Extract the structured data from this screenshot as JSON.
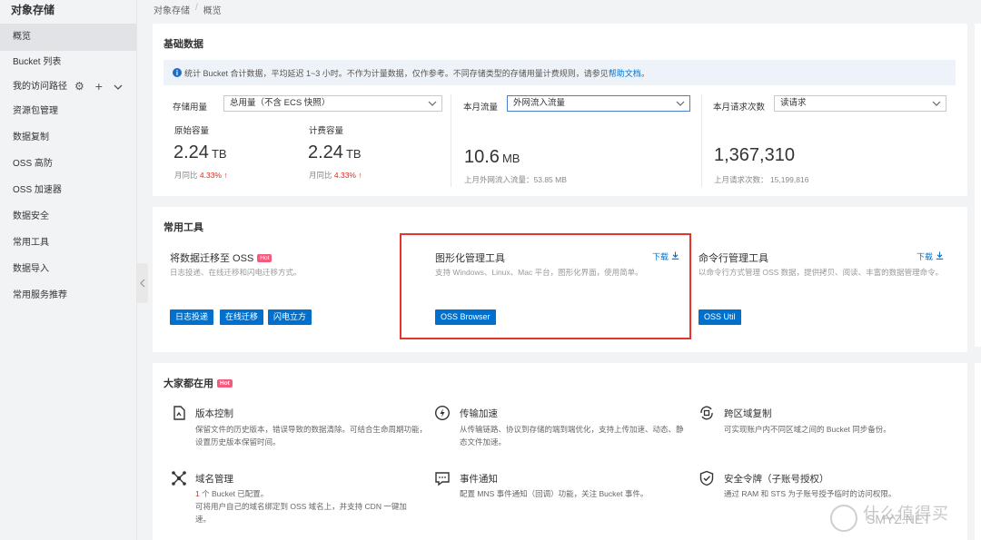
{
  "sidebar": {
    "title": "对象存储",
    "items": [
      "概览",
      "Bucket 列表",
      "我的访问路径",
      "资源包管理",
      "数据复制",
      "OSS 高防",
      "OSS 加速器",
      "数据安全",
      "常用工具",
      "数据导入",
      "常用服务推荐"
    ],
    "path_icons": [
      "gear-icon",
      "plus-icon",
      "chevron-down-icon"
    ]
  },
  "breadcrumb": [
    "对象存储",
    "概览"
  ],
  "basic": {
    "title": "基础数据",
    "info_text": "统计 Bucket 合计数据，平均延迟 1~3 小时。不作为计量数据，仅作参考。不同存储类型的存储用量计费规则，请参见",
    "info_link": "帮助文档",
    "info_end": "。",
    "storage": {
      "label": "存储用量",
      "select": "总用量（不含 ECS 快照）",
      "raw_label": "原始容量",
      "raw_value": "2.24",
      "raw_unit": "TB",
      "raw_mom_label": "月同比",
      "raw_mom": "4.33%",
      "bill_label": "计费容量",
      "bill_value": "2.24",
      "bill_unit": "TB",
      "bill_mom_label": "月同比",
      "bill_mom": "4.33%",
      "up_arrow": "↑"
    },
    "traffic": {
      "label": "本月流量",
      "select": "外网流入流量",
      "value": "10.6",
      "unit": "MB",
      "prev": "上月外网流入流量：53.85 MB"
    },
    "requests": {
      "label": "本月请求次数",
      "select": "读请求",
      "value": "1,367,310",
      "prev_label": "上月请求次数：",
      "prev_value": "15,199,816"
    }
  },
  "tools": {
    "title": "常用工具",
    "hot": "Hot",
    "download": "下载",
    "items": [
      {
        "name": "将数据迁移至 OSS",
        "desc": "日志投递、在线迁移和闪电迁移方式。",
        "buttons": [
          "日志投递",
          "在线迁移",
          "闪电立方"
        ]
      },
      {
        "name": "图形化管理工具",
        "desc": "支持 Windows、Linux、Mac 平台，图形化界面，使用简单。",
        "buttons": [
          "OSS Browser"
        ]
      },
      {
        "name": "命令行管理工具",
        "desc": "以命令行方式管理 OSS 数据，提供拷贝、阅读、丰富的数据管理命令。",
        "buttons": [
          "OSS Util"
        ]
      }
    ]
  },
  "popular": {
    "title": "大家都在用",
    "hot": "Hot",
    "items": [
      {
        "name": "版本控制",
        "desc": "保留文件的历史版本，错误导致的数据清除。可结合生命周期功能，设置历史版本保留时间。",
        "icon": "document-icon"
      },
      {
        "name": "传输加速",
        "desc": "从传输链路、协议到存储的端到端优化，支持上传加速、动态、静态文件加速。",
        "icon": "lightning-icon"
      },
      {
        "name": "跨区域复制",
        "desc": "可实现账户内不同区域之间的 Bucket 同步备份。",
        "icon": "region-copy-icon"
      },
      {
        "name": "域名管理",
        "count": "1",
        "count_text": " 个 Bucket 已配置。",
        "desc": "可将用户自己的域名绑定到 OSS 域名上，并支持 CDN 一键加速。",
        "icon": "network-icon"
      },
      {
        "name": "事件通知",
        "desc": "配置 MNS 事件通知（回调）功能，关注 Bucket 事件。",
        "icon": "message-icon"
      },
      {
        "name": "安全令牌（子账号授权）",
        "desc": "通过 RAM 和 STS 为子账号授予临时的访问权限。",
        "icon": "shield-icon"
      }
    ]
  },
  "watermark": {
    "text": "什么值得买",
    "sub": "SMYZ.NET"
  }
}
